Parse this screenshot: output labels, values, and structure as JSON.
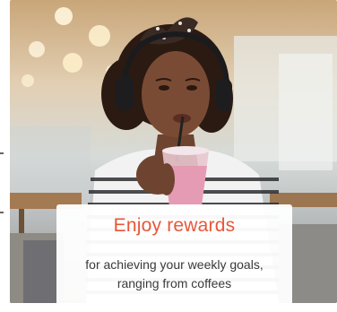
{
  "promo": {
    "image": "woman-with-headphones-drinking-smoothie",
    "title": "Enjoy rewards",
    "body": "for achieving your weekly goals, ranging from coffees"
  },
  "colors": {
    "title": "#e8573a",
    "body_text": "#3a3a3a",
    "card_bg": "#ffffff"
  }
}
